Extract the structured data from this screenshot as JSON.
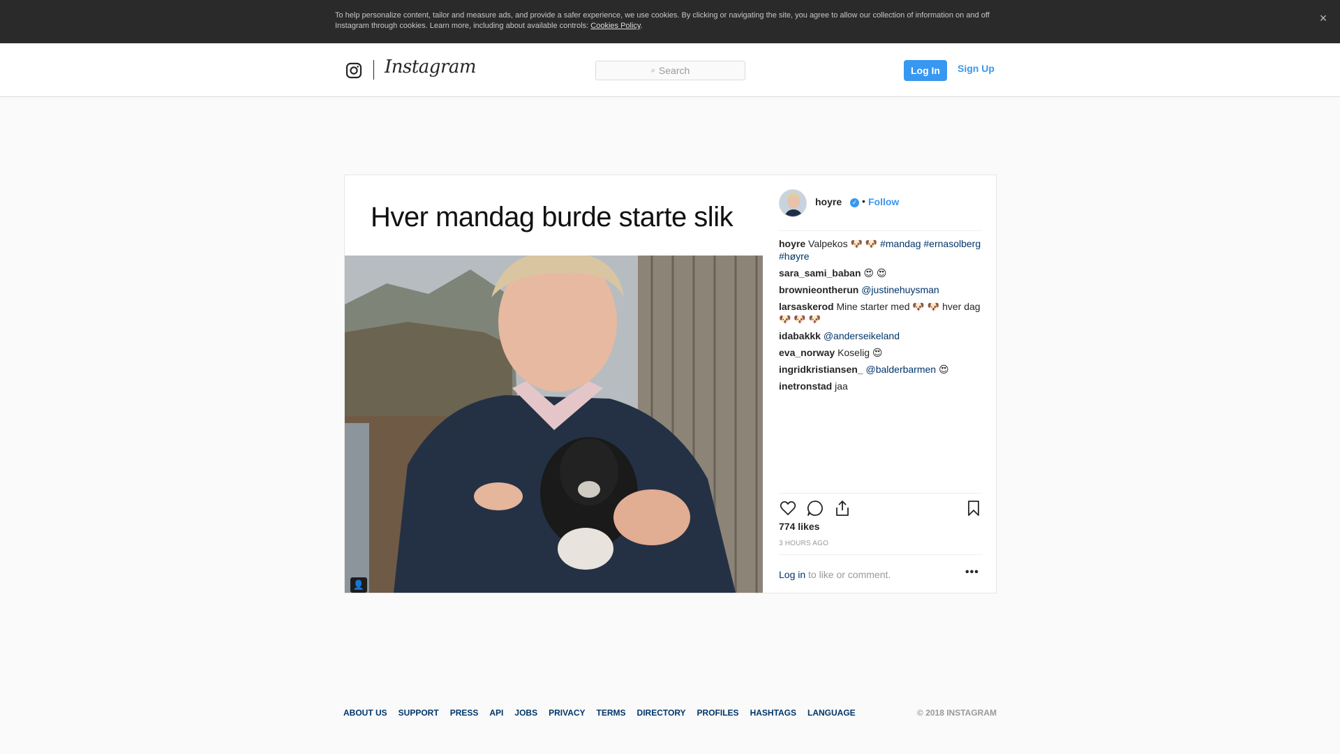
{
  "cookie_banner": {
    "text": "To help personalize content, tailor and measure ads, and provide a safer experience, we use cookies. By clicking or navigating the site, you agree to allow our collection of information on and off Instagram through cookies. Learn more, including about available controls: ",
    "link_label": "Cookies Policy",
    "end": ".",
    "close_icon": "×"
  },
  "header": {
    "brand": "Instagram",
    "search_placeholder": "Search",
    "search_icon": "⌕",
    "login_label": "Log In",
    "signup_label": "Sign Up"
  },
  "post": {
    "image_headline": "Hver mandag burde starte slik",
    "tag_icon": "👤",
    "author": "hoyre",
    "verified_mark": "✓",
    "separator": "•",
    "follow_label": "Follow",
    "comments": [
      {
        "user": "hoyre",
        "text": "Valpekos 🐶 🐶 ",
        "links": [
          "#mandag",
          "#ernasolberg",
          "#høyre"
        ]
      },
      {
        "user": "sara_sami_baban",
        "text": "😍 😍",
        "links": []
      },
      {
        "user": "brownieontherun",
        "text": "",
        "links": [
          "@justinehuysman"
        ]
      },
      {
        "user": "larsaskerod",
        "text": "Mine starter med 🐶 🐶  hver dag🐶 🐶 🐶",
        "links": []
      },
      {
        "user": "idabakkk",
        "text": "",
        "links": [
          "@anderseikeland"
        ]
      },
      {
        "user": "eva_norway",
        "text": "Koselig 😍",
        "links": []
      },
      {
        "user": "ingridkristiansen_",
        "text": "",
        "links": [
          "@balderbarmen"
        ],
        "suffix": " 😍"
      },
      {
        "user": "inetronstad",
        "text": "jaa",
        "links": []
      }
    ],
    "likes": "774 likes",
    "time_ago": "3 HOURS AGO",
    "login_link": "Log in",
    "login_rest": " to like or comment.",
    "more_icon": "•••"
  },
  "footer": {
    "links": [
      "ABOUT US",
      "SUPPORT",
      "PRESS",
      "API",
      "JOBS",
      "PRIVACY",
      "TERMS",
      "DIRECTORY",
      "PROFILES",
      "HASHTAGS",
      "LANGUAGE"
    ],
    "copyright": "© 2018 INSTAGRAM"
  }
}
